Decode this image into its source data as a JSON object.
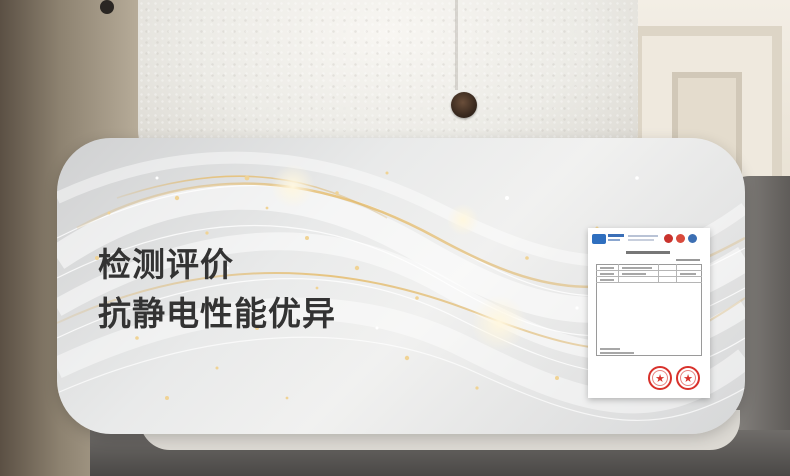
{
  "card": {
    "title": "检测评价",
    "subtitle": "抗静电性能优异"
  },
  "colors": {
    "title_text": "#333333",
    "wave_gold": "#d9b26a",
    "wave_white": "#ffffff",
    "seal_red": "#d8312b",
    "report_logo_blue": "#2f6fbf"
  },
  "icons": {
    "report_seal": "red-star-seal",
    "report_logo": "blue-organization-logo"
  }
}
